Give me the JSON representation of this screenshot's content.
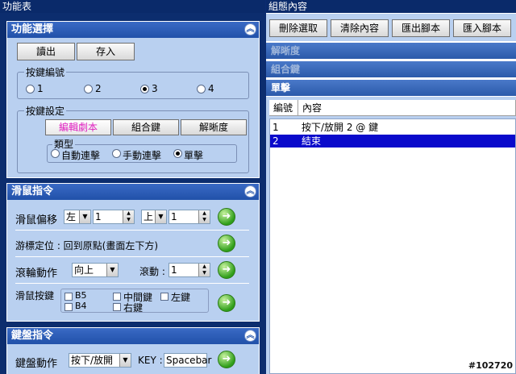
{
  "left": {
    "title": "功能表",
    "function_select": {
      "header": "功能選擇",
      "read_label": "讀出",
      "save_label": "存入",
      "key_number": {
        "legend": "按鍵編號",
        "options": [
          "1",
          "2",
          "3",
          "4"
        ],
        "selected": "3"
      },
      "key_setting": {
        "legend": "按鍵設定",
        "tabs": [
          "編輯劇本",
          "組合鍵",
          "解晰度"
        ],
        "type": {
          "legend": "類型",
          "options": [
            "自動連擊",
            "手動連擊",
            "單擊"
          ],
          "selected": "單擊"
        }
      }
    },
    "mouse_command": {
      "header": "滑鼠指令",
      "offset_label": "滑鼠偏移",
      "h_dir": "左",
      "h_value": "1",
      "v_dir": "上",
      "v_value": "1",
      "cursor_pos_label": "游標定位 : 回到原點(畫面左下方)",
      "wheel_label": "滾輪動作",
      "wheel_dir": "向上",
      "scroll_label": "滾動 :",
      "scroll_value": "1",
      "button_label": "滑鼠按鍵",
      "buttons": [
        "B5",
        "中間鍵",
        "左鍵",
        "B4",
        "右鍵"
      ]
    },
    "keyboard_command": {
      "header": "鍵盤指令",
      "action_label": "鍵盤動作",
      "action_value": "按下/放開",
      "key_label": "KEY :",
      "key_value": "Spacebar"
    },
    "go_icon": "arrow-right"
  },
  "right": {
    "title": "組態內容",
    "toolbar": [
      "刪除選取",
      "清除內容",
      "匯出腳本",
      "匯入腳本"
    ],
    "sections": [
      "解晰度",
      "組合鍵",
      "單擊"
    ],
    "columns": [
      "編號",
      "內容"
    ],
    "rows": [
      {
        "no": "1",
        "content": "按下/放開 2 @ 鍵"
      },
      {
        "no": "2",
        "content": "結束"
      }
    ],
    "watermark": "#102720"
  },
  "colors": {
    "selection": "#0a0acb",
    "panel": "#b9d0f0",
    "header": "#2b5aaa",
    "active_tab_text": "#e020c0"
  }
}
